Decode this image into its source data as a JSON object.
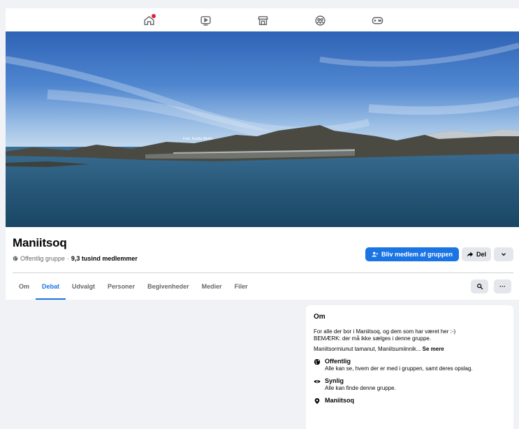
{
  "cover": {
    "credit": "Foto: Karlda Media"
  },
  "group": {
    "name": "Maniitsoq",
    "privacy": "Offentlig gruppe",
    "separator": " · ",
    "members": "9,3 tusind medlemmer"
  },
  "actions": {
    "join_label": "Bliv medlem af gruppen",
    "share_label": "Del",
    "more_glyph": "⌄"
  },
  "tabs": [
    {
      "label": "Om"
    },
    {
      "label": "Debat"
    },
    {
      "label": "Udvalgt"
    },
    {
      "label": "Personer"
    },
    {
      "label": "Begivenheder"
    },
    {
      "label": "Medier"
    },
    {
      "label": "Filer"
    }
  ],
  "tab_more_glyph": "···",
  "about": {
    "title": "Om",
    "description_line1": "For alle der bor i Maniitsoq, og dem som har været her :-)",
    "description_line2": "BEMÆRK: der må ikke sælges i denne gruppe.",
    "description2": "Maniitsormiunut tamanut, Maniitsumiinnik... ",
    "see_more": "Se mere",
    "public_title": "Offentlig",
    "public_desc": "Alle kan se, hvem der er med i gruppen, samt deres opslag.",
    "visible_title": "Synlig",
    "visible_desc": "Alle kan finde denne gruppe.",
    "location": "Maniitsoq"
  },
  "colors": {
    "accent": "#1b74e4",
    "notification": "#e41e3f",
    "background": "#f0f2f5"
  }
}
